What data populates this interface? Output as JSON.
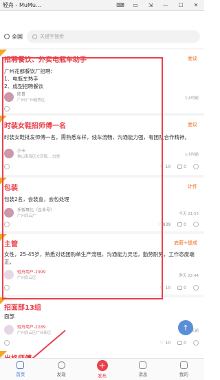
{
  "window": {
    "title": "轻舟 - MuMu...",
    "controls": [
      "⌨",
      "▭",
      "⇲",
      "—",
      "☐",
      "✕"
    ]
  },
  "search": {
    "city_label": "全国",
    "placeholder": "关键字搜索"
  },
  "cards": [
    {
      "title": "招聘餐饮、外卖电瓶车助手",
      "tag": "面谈",
      "body": "广州花都餐饮厂招聘:\n1、电瓶车熟手\n2、成型招聘餐饮",
      "author": "陈哥",
      "location": "广州/广州越秀区",
      "time": "1小时前",
      "likes": "",
      "comments": ""
    },
    {
      "title": "时装女鞋招师傅一名",
      "tag": "面议",
      "body": "时装女鞋批发师傅一名，需熟悉车样，线车流畅，沟通能力强，有团队合作精神。",
      "author": "小卡",
      "location": "佛山南海区大沥镇... 白领",
      "time": "1小时前",
      "likes": "10",
      "comments": "0"
    },
    {
      "title": "包装",
      "tag": "计件",
      "body": "包装2名，会装盒，会包处理",
      "author": "乐饭哥比（企业号）",
      "location": "广州白云广",
      "time": "今天 21:55",
      "likes": "839",
      "comments": "0"
    },
    {
      "title": "主管",
      "tag": "底薪+提成",
      "body": "女性，25-45岁，熟悉对话团购单生产流程，沟通能力灵活，勤劳耐劳，工作态度端正。",
      "author": "轻舟用户-2999",
      "location": "广州白云区",
      "time": "昨天 22:44",
      "likes": "10",
      "comments": "0"
    },
    {
      "title": "招面部13组",
      "tag": "",
      "body": "面部",
      "author": "轻舟用户-2289",
      "location": "广州白云区广州新区",
      "time": "3天前",
      "likes": "10",
      "comments": "0"
    },
    {
      "title": "出格师傅",
      "tag": "",
      "body": "",
      "author": "",
      "location": "",
      "time": "",
      "likes": "",
      "comments": ""
    }
  ],
  "float_button": "↑",
  "nav": {
    "items": [
      "首页",
      "发现",
      "发布",
      "消息",
      "我的"
    ],
    "publish_symbol": "+"
  },
  "colors": {
    "accent_red": "#e8414b",
    "tag_orange": "#f26b1d",
    "active_blue": "#4a7bd0"
  }
}
